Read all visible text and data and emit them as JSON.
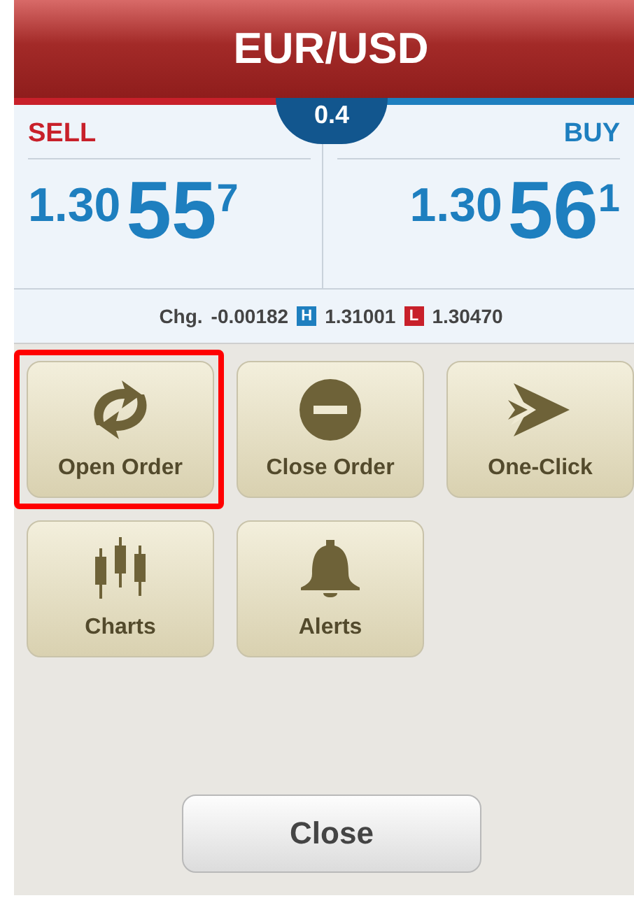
{
  "header": {
    "title": "EUR/USD"
  },
  "spread": "0.4",
  "quotes": [
    {
      "side": "SELL",
      "big": "1.30",
      "pips": "55",
      "fraction": "7",
      "color": "#c8202a"
    },
    {
      "side": "BUY",
      "big": "1.30",
      "pips": "56",
      "fraction": "1",
      "color": "#1e7fbf"
    }
  ],
  "stats": {
    "change_label": "Chg.",
    "change": "-0.00182",
    "high_mark": "H",
    "high": "1.31001",
    "low_mark": "L",
    "low": "1.30470"
  },
  "actions": [
    {
      "kind": "open",
      "label": "Open Order",
      "highlighted": true
    },
    {
      "kind": "close",
      "label": "Close Order",
      "highlighted": false
    },
    {
      "kind": "oneclick",
      "label": "One-Click",
      "highlighted": false
    },
    {
      "kind": "charts",
      "label": "Charts",
      "highlighted": false
    },
    {
      "kind": "alerts",
      "label": "Alerts",
      "highlighted": false
    }
  ],
  "close_button": "Close"
}
